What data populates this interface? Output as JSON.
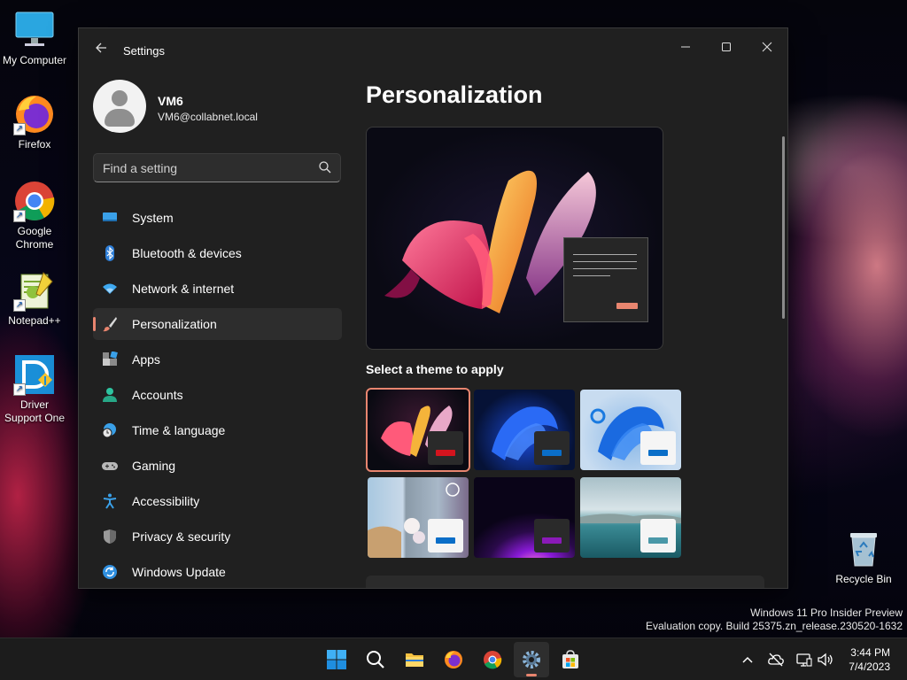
{
  "desktop": {
    "icons": [
      {
        "label": "My Computer"
      },
      {
        "label": "Firefox"
      },
      {
        "label": "Google Chrome"
      },
      {
        "label": "Notepad++"
      },
      {
        "label": "Driver Support One"
      },
      {
        "label": "Recycle Bin"
      }
    ],
    "watermark": {
      "line1": "Windows 11 Pro Insider Preview",
      "line2": "Evaluation copy. Build 25375.zn_release.230520-1632"
    }
  },
  "window": {
    "title": "Settings",
    "profile": {
      "name": "VM6",
      "email": "VM6@collabnet.local"
    },
    "search": {
      "placeholder": "Find a setting",
      "value": ""
    },
    "nav": [
      {
        "label": "System",
        "icon": "monitor-icon"
      },
      {
        "label": "Bluetooth & devices",
        "icon": "bluetooth-icon"
      },
      {
        "label": "Network & internet",
        "icon": "wifi-icon"
      },
      {
        "label": "Personalization",
        "icon": "brush-icon",
        "active": true
      },
      {
        "label": "Apps",
        "icon": "apps-icon"
      },
      {
        "label": "Accounts",
        "icon": "person-icon"
      },
      {
        "label": "Time & language",
        "icon": "globe-clock-icon"
      },
      {
        "label": "Gaming",
        "icon": "gamepad-icon"
      },
      {
        "label": "Accessibility",
        "icon": "accessibility-icon"
      },
      {
        "label": "Privacy & security",
        "icon": "shield-icon"
      },
      {
        "label": "Windows Update",
        "icon": "update-icon"
      }
    ],
    "main": {
      "title": "Personalization",
      "theme_section_label": "Select a theme to apply",
      "selected_theme_index": 0
    }
  },
  "taskbar": {
    "clock": {
      "time": "3:44 PM",
      "date": "7/4/2023"
    },
    "accent": "#e8856f"
  }
}
